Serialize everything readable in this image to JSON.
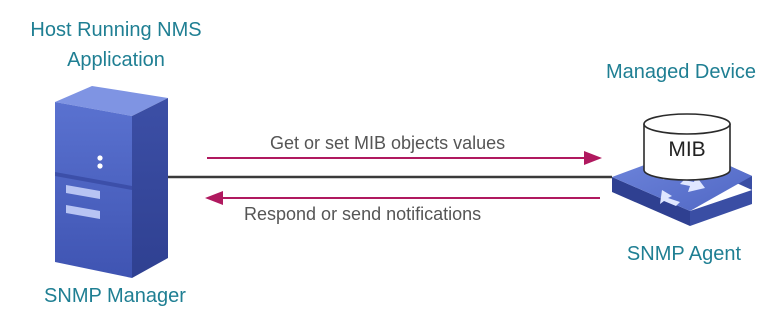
{
  "manager": {
    "host_label_line1": "Host Running NMS",
    "host_label_line2": "Application",
    "role_label": "SNMP Manager"
  },
  "device": {
    "title": "Managed Device",
    "mib_label": "MIB",
    "role_label": "SNMP Agent"
  },
  "arrows": {
    "request_label": "Get or set MIB objects values",
    "response_label": "Respond or send notifications"
  },
  "colors": {
    "label_teal": "#1f7f93",
    "arrow_magenta": "#b0195f",
    "link_dark": "#3a3a3a",
    "server_blue": "#4c62c0",
    "text_gray": "#555555"
  },
  "icons": {
    "manager": "server-tower-icon",
    "agent": "network-switch-icon",
    "mib": "database-cylinder-icon"
  }
}
